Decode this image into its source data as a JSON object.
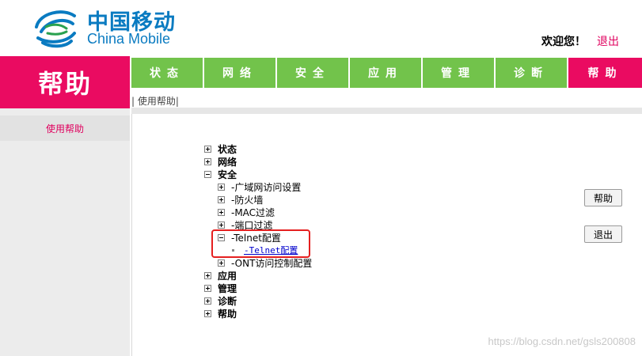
{
  "header": {
    "logo_cn": "中国移动",
    "logo_en": "China Mobile",
    "welcome": "欢迎您！",
    "logout": "退出"
  },
  "left_title": "帮助",
  "nav": {
    "tabs": [
      {
        "label": "状态"
      },
      {
        "label": "网络"
      },
      {
        "label": "安全"
      },
      {
        "label": "应用"
      },
      {
        "label": "管理"
      },
      {
        "label": "诊断"
      },
      {
        "label": "帮助",
        "active": true
      }
    ]
  },
  "breadcrumb": "| 使用帮助|",
  "sidebar": {
    "items": [
      {
        "label": "使用帮助"
      }
    ]
  },
  "tree": {
    "status": "状态",
    "network": "网络",
    "security": "安全",
    "wan_access": "-广域网访问设置",
    "firewall": "-防火墙",
    "mac_filter": "-MAC过滤",
    "port_filter": "-端口过滤",
    "telnet_config": "-Telnet配置",
    "telnet_config_link": "-Telnet配置",
    "ont_access": "-ONT访问控制配置",
    "apps": "应用",
    "manage": "管理",
    "diagnose": "诊断",
    "help": "帮助"
  },
  "buttons": {
    "help": "帮助",
    "logout": "退出"
  },
  "watermark": "https://blog.csdn.net/gsls200808",
  "colors": {
    "brand_blue": "#0a7bc1",
    "nav_green": "#72c34b",
    "accent_pink": "#ea0b61",
    "highlight_red": "#e52020",
    "link_blue": "#0000cc"
  }
}
